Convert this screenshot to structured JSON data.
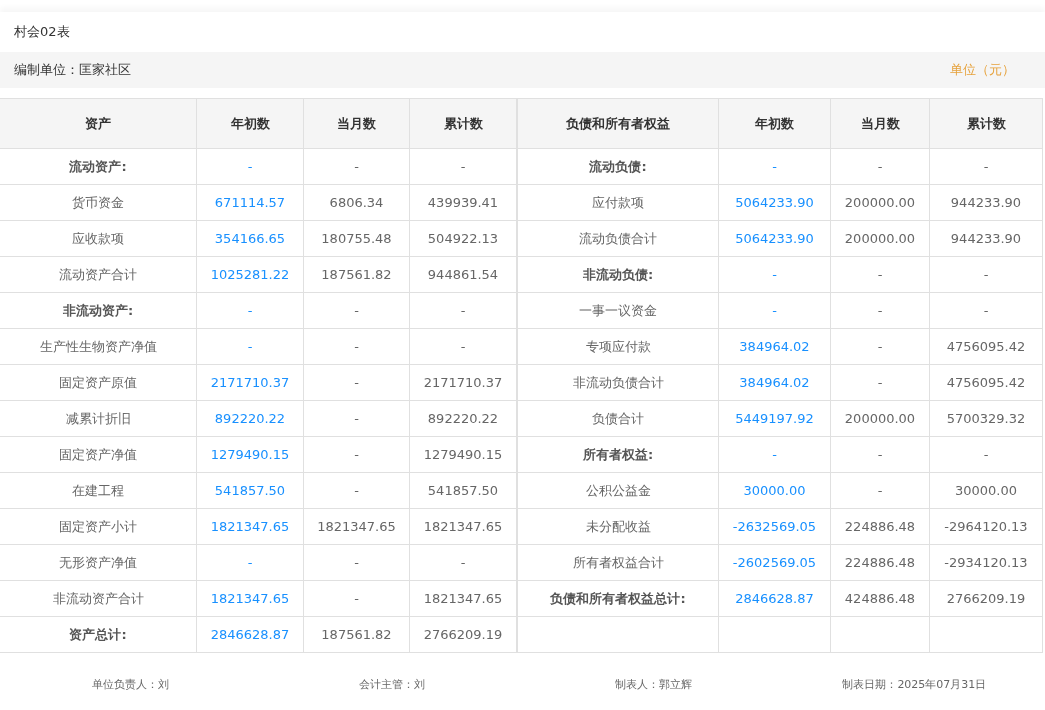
{
  "title": "村会02表",
  "unit_bar": {
    "org": "编制单位：匡家社区",
    "unit": "单位（元）"
  },
  "columns": {
    "left": [
      "资产",
      "年初数",
      "当月数",
      "累计数"
    ],
    "right": [
      "负债和所有者权益",
      "年初数",
      "当月数",
      "累计数"
    ]
  },
  "assets": [
    {
      "kind": "heading",
      "label": "流动资产:",
      "begin": "-",
      "month": "-",
      "total": "-"
    },
    {
      "kind": "item",
      "label": "货币资金",
      "begin": "671114.57",
      "month": "6806.34",
      "total": "439939.41"
    },
    {
      "kind": "item",
      "label": "应收款项",
      "begin": "354166.65",
      "month": "180755.48",
      "total": "504922.13"
    },
    {
      "kind": "item",
      "label": "流动资产合计",
      "begin": "1025281.22",
      "month": "187561.82",
      "total": "944861.54"
    },
    {
      "kind": "heading",
      "label": "非流动资产:",
      "begin": "-",
      "month": "-",
      "total": "-"
    },
    {
      "kind": "item",
      "label": "生产性生物资产净值",
      "begin": "-",
      "month": "-",
      "total": "-"
    },
    {
      "kind": "item",
      "label": "固定资产原值",
      "begin": "2171710.37",
      "month": "-",
      "total": "2171710.37"
    },
    {
      "kind": "item",
      "label": "减累计折旧",
      "begin": "892220.22",
      "month": "-",
      "total": "892220.22"
    },
    {
      "kind": "item",
      "label": "固定资产净值",
      "begin": "1279490.15",
      "month": "-",
      "total": "1279490.15"
    },
    {
      "kind": "item",
      "label": "在建工程",
      "begin": "541857.50",
      "month": "-",
      "total": "541857.50"
    },
    {
      "kind": "item",
      "label": "固定资产小计",
      "begin": "1821347.65",
      "month": "1821347.65",
      "total": "1821347.65"
    },
    {
      "kind": "item",
      "label": "无形资产净值",
      "begin": "-",
      "month": "-",
      "total": "-"
    },
    {
      "kind": "item",
      "label": "非流动资产合计",
      "begin": "1821347.65",
      "month": "-",
      "total": "1821347.65"
    },
    {
      "kind": "heading",
      "label": "资产总计:",
      "begin": "2846628.87",
      "month": "187561.82",
      "total": "2766209.19"
    }
  ],
  "liabilities": [
    {
      "kind": "heading",
      "label": "流动负债:",
      "begin": "-",
      "month": "-",
      "total": "-"
    },
    {
      "kind": "item",
      "label": "应付款项",
      "begin": "5064233.90",
      "month": "200000.00",
      "total": "944233.90"
    },
    {
      "kind": "item",
      "label": "流动负债合计",
      "begin": "5064233.90",
      "month": "200000.00",
      "total": "944233.90"
    },
    {
      "kind": "heading",
      "label": "非流动负债:",
      "begin": "-",
      "month": "-",
      "total": "-"
    },
    {
      "kind": "item",
      "label": "一事一议资金",
      "begin": "-",
      "month": "-",
      "total": "-"
    },
    {
      "kind": "item",
      "label": "专项应付款",
      "begin": "384964.02",
      "month": "-",
      "total": "4756095.42"
    },
    {
      "kind": "item",
      "label": "非流动负债合计",
      "begin": "384964.02",
      "month": "-",
      "total": "4756095.42"
    },
    {
      "kind": "item",
      "label": "负债合计",
      "begin": "5449197.92",
      "month": "200000.00",
      "total": "5700329.32"
    },
    {
      "kind": "heading",
      "label": "所有者权益:",
      "begin": "-",
      "month": "-",
      "total": "-"
    },
    {
      "kind": "item",
      "label": "公积公益金",
      "begin": "30000.00",
      "month": "-",
      "total": "30000.00"
    },
    {
      "kind": "item",
      "label": "未分配收益",
      "begin": "-2632569.05",
      "month": "224886.48",
      "total": "-2964120.13"
    },
    {
      "kind": "item",
      "label": "所有者权益合计",
      "begin": "-2602569.05",
      "month": "224886.48",
      "total": "-2934120.13"
    },
    {
      "kind": "heading",
      "label": "负债和所有者权益总计:",
      "begin": "2846628.87",
      "month": "424886.48",
      "total": "2766209.19"
    }
  ],
  "footer": [
    "单位负责人：刘",
    "会计主管：刘",
    "制表人：郭立辉",
    "制表日期：2025年07月31日"
  ]
}
